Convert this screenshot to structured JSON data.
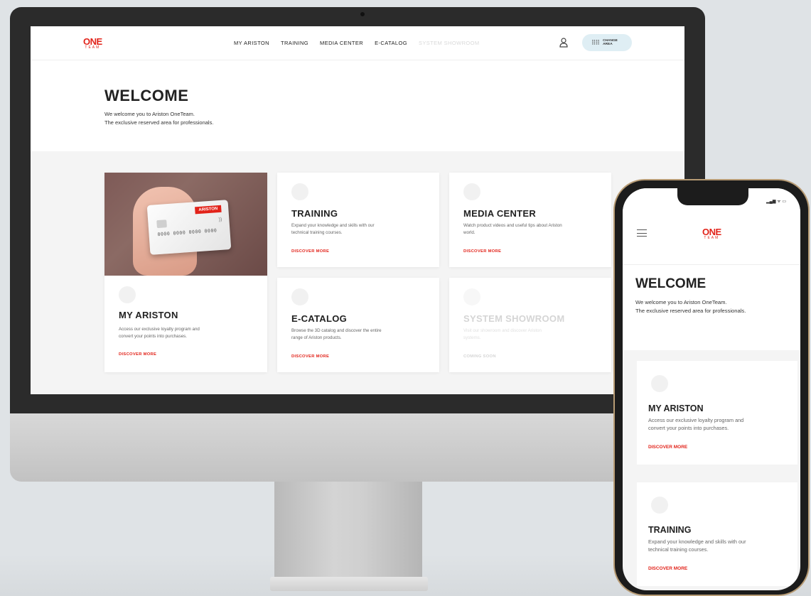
{
  "brand": {
    "logo_text": "ONE",
    "logo_sub": "TEAM",
    "accent": "#e2231a"
  },
  "nav": {
    "items": [
      "MY ARISTON",
      "TRAINING",
      "MEDIA CENTER",
      "E-CATALOG",
      "SYSTEM SHOWROOM"
    ],
    "change_area": "CHANGE AREA"
  },
  "welcome": {
    "title": "WELCOME",
    "line1": "We welcome you to Ariston OneTeam.",
    "line2": "The exclusive reserved area for professionals."
  },
  "cards": {
    "my_ariston": {
      "title": "MY ARISTON",
      "line1": "Access our exclusive loyalty program and",
      "line2": "convert your points into purchases.",
      "link": "DISCOVER MORE"
    },
    "training": {
      "title": "TRAINING",
      "line1": "Expand your knowledge and skills with our",
      "line2": "technical training courses.",
      "link": "DISCOVER MORE"
    },
    "media_center": {
      "title": "MEDIA CENTER",
      "line1": "Watch product videos and useful tips about Ariston",
      "line2": "world.",
      "link": "DISCOVER MORE"
    },
    "e_catalog": {
      "title": "E-CATALOG",
      "line1": "Browse the 3D catalog and discover the entire",
      "line2": "range of Ariston products.",
      "link": "DISCOVER MORE"
    },
    "system_showroom": {
      "title": "SYSTEM SHOWROOM",
      "line1": "Visit our showroom and discover Ariston",
      "line2": "systems.",
      "link": "COMING SOON"
    }
  },
  "bank_card": {
    "brand": "ARISTON",
    "number": "0000 0000 0000 0000"
  },
  "phone": {
    "status": "▂▄▆ ᯤ ▭"
  }
}
